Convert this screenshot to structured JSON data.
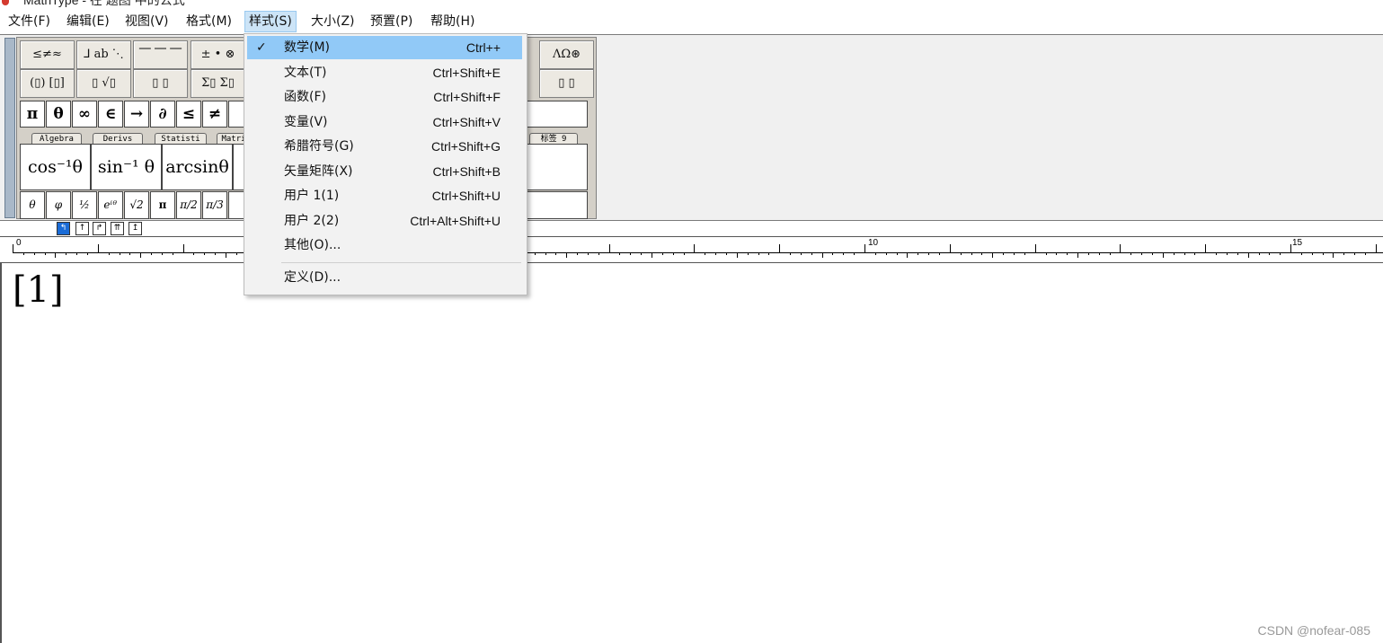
{
  "app": {
    "title": "MathType - 在 题图 中的公式"
  },
  "menubar": [
    {
      "label": "文件(F)",
      "x": 0
    },
    {
      "label": "编辑(E)",
      "x": 0
    },
    {
      "label": "视图(V)",
      "x": 0
    },
    {
      "label": "格式(M)",
      "x": 0
    },
    {
      "label": "样式(S)",
      "x": 0
    },
    {
      "label": "大小(Z)",
      "x": 0
    },
    {
      "label": "预置(P)",
      "x": 0
    },
    {
      "label": "帮助(H)",
      "x": 0
    }
  ],
  "palette": {
    "row1": [
      "≤≠≈",
      "⅃ ab ⋱",
      "⎺ ⎺ ⎺",
      "± • ⊗",
      "ΛΩ⊛"
    ],
    "row2": [
      "(▯) [▯]",
      "▯ √▯",
      "▯ ▯",
      "Σ▯ Σ▯",
      "▯ ▯"
    ],
    "symbols": [
      "π",
      "θ",
      "∞",
      "∈",
      "→",
      "∂",
      "≤",
      "≠"
    ],
    "tabs": [
      "Algebra",
      "Derivs",
      "Statisti",
      "Matri",
      "标签 9"
    ],
    "templates": [
      "cos⁻¹θ",
      "sin⁻¹ θ",
      "arcsinθ"
    ],
    "small": [
      "θ",
      "φ",
      "½",
      "eⁱᶿ",
      "√2",
      "π",
      "π/2",
      "π/3"
    ]
  },
  "nudge": [
    "↰",
    "↑",
    "↱",
    "⇈",
    "↥"
  ],
  "ruler": {
    "labels": [
      "0",
      "10",
      "15"
    ]
  },
  "editor": {
    "content": "[1]"
  },
  "dropdown": {
    "items": [
      {
        "label": "数学(M)",
        "shortcut": "Ctrl++",
        "checked": "✓"
      },
      {
        "label": "文本(T)",
        "shortcut": "Ctrl+Shift+E"
      },
      {
        "label": "函数(F)",
        "shortcut": "Ctrl+Shift+F"
      },
      {
        "label": "变量(V)",
        "shortcut": "Ctrl+Shift+V"
      },
      {
        "label": "希腊符号(G)",
        "shortcut": "Ctrl+Shift+G"
      },
      {
        "label": "矢量矩阵(X)",
        "shortcut": "Ctrl+Shift+B"
      },
      {
        "label": "用户 1(1)",
        "shortcut": "Ctrl+Shift+U"
      },
      {
        "label": "用户 2(2)",
        "shortcut": "Ctrl+Alt+Shift+U"
      },
      {
        "label": "其他(O)..."
      },
      {
        "label": "定义(D)..."
      }
    ]
  },
  "watermark": "CSDN @nofear-085"
}
